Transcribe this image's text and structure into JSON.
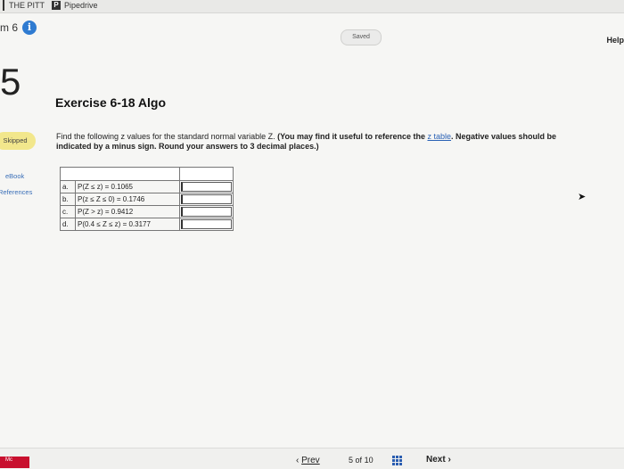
{
  "bookmarks": [
    {
      "label": "THE PITT"
    },
    {
      "label": "Pipedrive",
      "icon": "P"
    }
  ],
  "header": {
    "item_label": "m 6",
    "info_icon": "i",
    "saved_label": "Saved",
    "help_label": "Help"
  },
  "sidebar": {
    "question_number": "5",
    "status_badge": "Skipped",
    "ebook_label": "eBook",
    "references_label": "References"
  },
  "exercise": {
    "title": "Exercise 6-18 Algo",
    "prompt_plain": "Find the following z values for the standard normal variable Z. ",
    "prompt_bold_1": "(You may find it useful to reference the ",
    "prompt_link": "z table",
    "prompt_bold_2": ". Negative values should be indicated by a minus sign. Round your answers to 3 decimal places.)"
  },
  "table": {
    "rows": [
      {
        "letter": "a.",
        "expr": "P(Z ≤ z) = 0.1065",
        "answer": ""
      },
      {
        "letter": "b.",
        "expr": "P(z ≤ Z ≤ 0) = 0.1746",
        "answer": ""
      },
      {
        "letter": "c.",
        "expr": "P(Z > z) = 0.9412",
        "answer": ""
      },
      {
        "letter": "d.",
        "expr": "P(0.4 ≤ Z ≤ z) = 0.3177",
        "answer": ""
      }
    ]
  },
  "footer": {
    "logo_text": "Mc",
    "prev_label": "Prev",
    "page_current": "5",
    "page_of": "of",
    "page_total": "10",
    "next_label": "Next"
  },
  "colors": {
    "accent": "#2f7bd1",
    "skipped": "#f2e78c",
    "logo": "#c8102e"
  }
}
